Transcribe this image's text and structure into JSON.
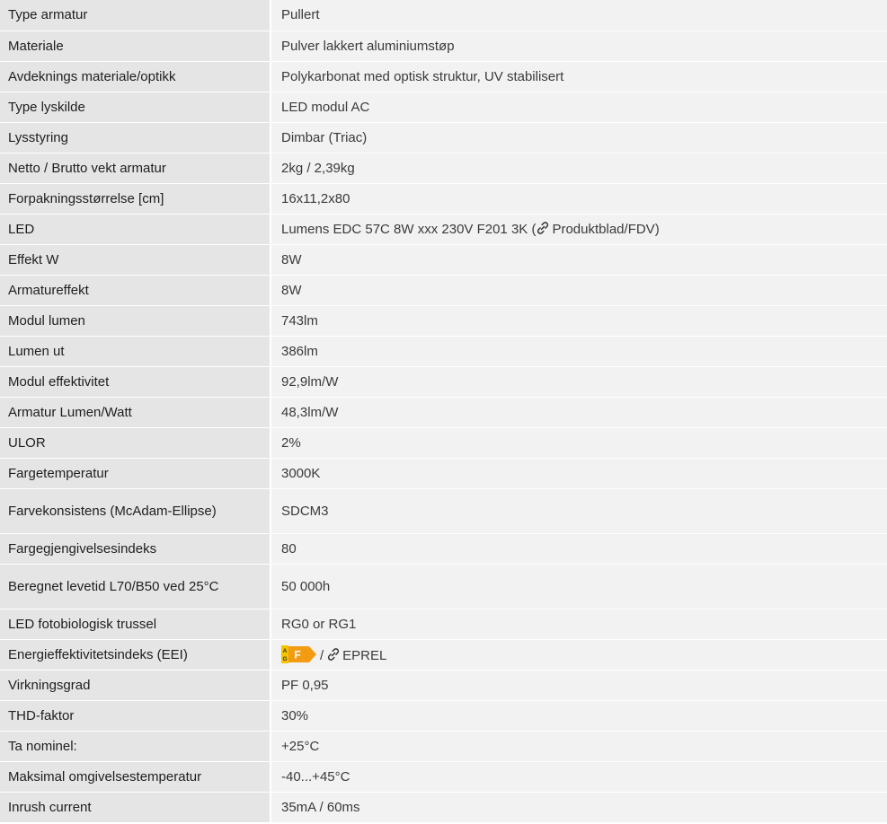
{
  "rows": [
    {
      "label": "Type armatur",
      "value": "Pullert"
    },
    {
      "label": "Materiale",
      "value": "Pulver lakkert aluminiumstøp"
    },
    {
      "label": "Avdeknings materiale/optikk",
      "value": "Polykarbonat med optisk struktur, UV stabilisert"
    },
    {
      "label": "Type lyskilde",
      "value": "LED modul AC"
    },
    {
      "label": "Lysstyring",
      "value": "Dimbar (Triac)"
    },
    {
      "label": "Netto / Brutto vekt armatur",
      "value": "2kg / 2,39kg"
    },
    {
      "label": "Forpakningsstørrelse [cm]",
      "value": "16x11,2x80"
    },
    {
      "label": "LED",
      "value_prefix": "Lumens EDC 57C 8W xxx 230V F201 3K (",
      "link_text": "Produktblad/FDV",
      "value_suffix": ")"
    },
    {
      "label": "Effekt W",
      "value": "8W"
    },
    {
      "label": "Armatureffekt",
      "value": "8W"
    },
    {
      "label": "Modul lumen",
      "value": "743lm"
    },
    {
      "label": "Lumen ut",
      "value": "386lm"
    },
    {
      "label": "Modul effektivitet",
      "value": "92,9lm/W"
    },
    {
      "label": "Armatur Lumen/Watt",
      "value": "48,3lm/W"
    },
    {
      "label": "ULOR",
      "value": "2%"
    },
    {
      "label": "Fargetemperatur",
      "value": "3000K"
    },
    {
      "label": "Farvekonsistens (McAdam-Ellipse)",
      "value": "SDCM3"
    },
    {
      "label": "Fargegjengivelsesindeks",
      "value": "80"
    },
    {
      "label": "Beregnet levetid L70/B50 ved 25°C",
      "value": "50 000h"
    },
    {
      "label": "LED fotobiologisk trussel",
      "value": "RG0 or RG1"
    },
    {
      "label": "Energieffektivitetsindeks (EEI)",
      "energy_class": "F",
      "energy_scale_top": "A",
      "energy_scale_bottom": "G",
      "separator": "/",
      "link_text": "EPREL"
    },
    {
      "label": "Virkningsgrad",
      "value": "PF 0,95"
    },
    {
      "label": "THD-faktor",
      "value": "30%"
    },
    {
      "label": "Ta nominel:",
      "value": "+25°C"
    },
    {
      "label": "Maksimal omgivelsestemperatur",
      "value": "-40...+45°C"
    },
    {
      "label": "Inrush current",
      "value": "35mA / 60ms"
    }
  ],
  "icons": {
    "link": "link-icon",
    "energy": "energy-label-icon"
  },
  "colors": {
    "label_bg": "#e5e5e5",
    "value_bg": "#f2f2f2",
    "energy_orange": "#f39c12",
    "energy_scale": "#f5c400"
  }
}
